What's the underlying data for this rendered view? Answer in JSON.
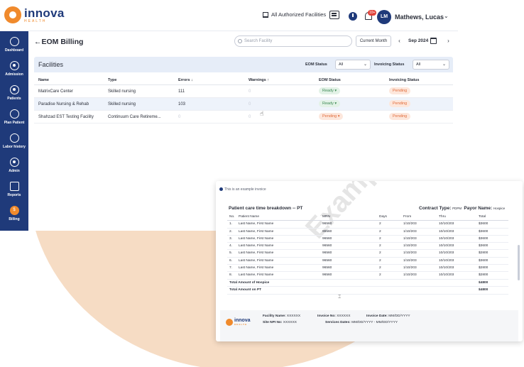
{
  "brand": {
    "name": "innova",
    "sub": "HEALTH"
  },
  "topbar": {
    "facility_switch": "All Authorized Facilities",
    "notification_count": "10+",
    "avatar_initials": "LM",
    "user_name": "Mathews, Lucas"
  },
  "sidebar": {
    "items": [
      {
        "label": "Dashboard"
      },
      {
        "label": "Admission"
      },
      {
        "label": "Patients"
      },
      {
        "label": "Plan Patient"
      },
      {
        "label": "Labor history"
      },
      {
        "label": "Admin"
      },
      {
        "label": "Reports"
      },
      {
        "label": "Billing",
        "badge": "$"
      }
    ]
  },
  "page": {
    "title": "EOM Billing",
    "search_placeholder": "Search Facility",
    "current_month_label": "Current Month",
    "month_value": "Sep 2024"
  },
  "facilities": {
    "title": "Facilities",
    "eom_status_label": "EOM Status",
    "eom_status_value": "All",
    "invoicing_status_label": "Invoicing Status",
    "invoicing_status_value": "All",
    "columns": [
      "Name",
      "Type",
      "Errors",
      "Warnings",
      "EOM Status",
      "Invoicing Status"
    ],
    "rows": [
      {
        "name": "MatrixCare Center",
        "type": "Skilled nursing",
        "errors": "111",
        "warnings": "0",
        "eom_status": "Ready",
        "invoicing_status": "Pending"
      },
      {
        "name": "Paradise Nursing & Rehab",
        "type": "Skilled nursing",
        "errors": "103",
        "warnings": "0",
        "eom_status": "Ready",
        "invoicing_status": "Pending"
      },
      {
        "name": "Shahzad EST Testing Facility",
        "type": "Continuum Care Retireme...",
        "errors": "0",
        "warnings": "0",
        "eom_status": "Pending",
        "invoicing_status": "Pending"
      }
    ]
  },
  "invoice": {
    "note": "This is an example invoice",
    "title": "Patient care time breakdown -- PT",
    "contract_type_label": "Contract Type:",
    "contract_type_value": "PDPM",
    "payor_name_label": "Payor Name:",
    "payor_name_value": "Hospice",
    "watermark": "Example",
    "columns": [
      "No.",
      "Patient Name",
      "MRN",
      "Days",
      "From",
      "Thru",
      "Total"
    ],
    "rows": [
      {
        "no": "1.",
        "name": "Last Name, First Name",
        "mrn": "96560",
        "days": "2",
        "from": "1/10/203",
        "thru": "10/10/203",
        "total": "$3600"
      },
      {
        "no": "2.",
        "name": "Last Name, First Name",
        "mrn": "96560",
        "days": "2",
        "from": "1/10/203",
        "thru": "10/10/203",
        "total": "$3600"
      },
      {
        "no": "3.",
        "name": "Last Name, First Name",
        "mrn": "96560",
        "days": "2",
        "from": "1/10/203",
        "thru": "10/10/203",
        "total": "$3600"
      },
      {
        "no": "4.",
        "name": "Last Name, First Name",
        "mrn": "96560",
        "days": "2",
        "from": "1/10/203",
        "thru": "10/10/203",
        "total": "$3600"
      },
      {
        "no": "5.",
        "name": "Last Name, First Name",
        "mrn": "96560",
        "days": "2",
        "from": "1/10/203",
        "thru": "10/10/203",
        "total": "$2800"
      },
      {
        "no": "6.",
        "name": "Last Name, First Name",
        "mrn": "96560",
        "days": "2",
        "from": "1/10/203",
        "thru": "10/10/203",
        "total": "$3600"
      },
      {
        "no": "7.",
        "name": "Last Name, First Name",
        "mrn": "96560",
        "days": "2",
        "from": "1/10/203",
        "thru": "10/10/203",
        "total": "$2800"
      },
      {
        "no": "8.",
        "name": "Last Name, First Name",
        "mrn": "96560",
        "days": "2",
        "from": "1/10/203",
        "thru": "10/10/203",
        "total": "$2800"
      }
    ],
    "total_hospice_label": "Total Amount of Hospice",
    "total_hospice_value": "$4800",
    "total_pt_label": "Total Amount on PT",
    "total_pt_value": "$4800",
    "footer": {
      "facility_name_label": "Facility Name:",
      "facility_name_value": "XXXXXX",
      "invoice_no_label": "Invoice No:",
      "invoice_no_value": "XXXXXX",
      "invoice_date_label": "Invoice Date:",
      "invoice_date_value": "MM/DD/YYYY",
      "site_npi_label": "Site NPI No:",
      "site_npi_value": "XXXXXX",
      "services_dates_label": "Services Dates:",
      "services_dates_value": "MM/DD/YYYY  -  MM/DD/YYYY"
    }
  }
}
